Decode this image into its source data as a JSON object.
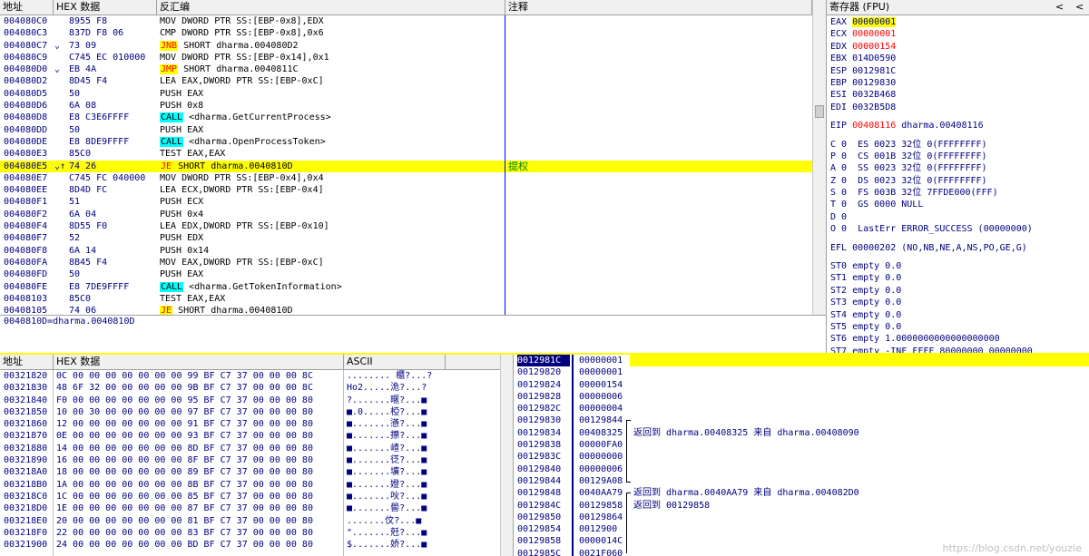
{
  "disasm": {
    "headers": {
      "addr": "地址",
      "hex": "HEX 数据",
      "disasm": "反汇编",
      "comment": "注释"
    },
    "rows": [
      {
        "addr": "004080C0",
        "mark": "",
        "hex": "8955 F8",
        "asm_pre": "MOV DWORD PTR SS:[EBP-0x8],EDX",
        "op": "",
        "asm_post": "",
        "comment": ""
      },
      {
        "addr": "004080C3",
        "mark": "",
        "hex": "837D F8 06",
        "asm_pre": "CMP DWORD PTR SS:[EBP-0x8],0x6",
        "op": "",
        "asm_post": "",
        "comment": ""
      },
      {
        "addr": "004080C7",
        "mark": "⌄",
        "hex": "73 09",
        "asm_pre": "",
        "op": "JNB",
        "optype": "jmp",
        "asm_post": " SHORT dharma.004080D2",
        "comment": ""
      },
      {
        "addr": "004080C9",
        "mark": "",
        "hex": "C745 EC 010000",
        "asm_pre": "MOV DWORD PTR SS:[EBP-0x14],0x1",
        "op": "",
        "asm_post": "",
        "comment": ""
      },
      {
        "addr": "004080D0",
        "mark": "⌄",
        "hex": "EB 4A",
        "asm_pre": "",
        "op": "JMP",
        "optype": "jmp",
        "asm_post": " SHORT dharma.0040811C",
        "comment": ""
      },
      {
        "addr": "004080D2",
        "mark": "",
        "hex": "8D45 F4",
        "asm_pre": "LEA EAX,DWORD PTR SS:[EBP-0xC]",
        "op": "",
        "asm_post": "",
        "comment": ""
      },
      {
        "addr": "004080D5",
        "mark": "",
        "hex": "50",
        "asm_pre": "PUSH EAX",
        "op": "",
        "asm_post": "",
        "comment": ""
      },
      {
        "addr": "004080D6",
        "mark": "",
        "hex": "6A 08",
        "asm_pre": "PUSH 0x8",
        "op": "",
        "asm_post": "",
        "comment": ""
      },
      {
        "addr": "004080D8",
        "mark": "",
        "hex": "E8 C3E6FFFF",
        "asm_pre": "",
        "op": "CALL",
        "optype": "call",
        "asm_post": " <dharma.GetCurrentProcess>",
        "comment": ""
      },
      {
        "addr": "004080DD",
        "mark": "",
        "hex": "50",
        "asm_pre": "PUSH EAX",
        "op": "",
        "asm_post": "",
        "comment": ""
      },
      {
        "addr": "004080DE",
        "mark": "",
        "hex": "E8 8DE9FFFF",
        "asm_pre": "",
        "op": "CALL",
        "optype": "call",
        "asm_post": " <dharma.OpenProcessToken>",
        "comment": ""
      },
      {
        "addr": "004080E3",
        "mark": "",
        "hex": "85C0",
        "asm_pre": "TEST EAX,EAX",
        "op": "",
        "asm_post": "",
        "comment": ""
      },
      {
        "addr": "004080E5",
        "mark": "⌄↑",
        "hex": "74 26",
        "asm_pre": "",
        "op": "JE",
        "optype": "jmpsel",
        "asm_post": " SHORT dharma.0040810D",
        "comment": "提权",
        "selected": true
      },
      {
        "addr": "004080E7",
        "mark": "",
        "hex": "C745 FC 040000",
        "asm_pre": "MOV DWORD PTR SS:[EBP-0x4],0x4",
        "op": "",
        "asm_post": "",
        "comment": ""
      },
      {
        "addr": "004080EE",
        "mark": "",
        "hex": "8D4D FC",
        "asm_pre": "LEA ECX,DWORD PTR SS:[EBP-0x4]",
        "op": "",
        "asm_post": "",
        "comment": ""
      },
      {
        "addr": "004080F1",
        "mark": "",
        "hex": "51",
        "asm_pre": "PUSH ECX",
        "op": "",
        "asm_post": "",
        "comment": ""
      },
      {
        "addr": "004080F2",
        "mark": "",
        "hex": "6A 04",
        "asm_pre": "PUSH 0x4",
        "op": "",
        "asm_post": "",
        "comment": ""
      },
      {
        "addr": "004080F4",
        "mark": "",
        "hex": "8D55 F0",
        "asm_pre": "LEA EDX,DWORD PTR SS:[EBP-0x10]",
        "op": "",
        "asm_post": "",
        "comment": ""
      },
      {
        "addr": "004080F7",
        "mark": "",
        "hex": "52",
        "asm_pre": "PUSH EDX",
        "op": "",
        "asm_post": "",
        "comment": ""
      },
      {
        "addr": "004080F8",
        "mark": "",
        "hex": "6A 14",
        "asm_pre": "PUSH 0x14",
        "op": "",
        "asm_post": "",
        "comment": ""
      },
      {
        "addr": "004080FA",
        "mark": "",
        "hex": "8B45 F4",
        "asm_pre": "MOV EAX,DWORD PTR SS:[EBP-0xC]",
        "op": "",
        "asm_post": "",
        "comment": ""
      },
      {
        "addr": "004080FD",
        "mark": "",
        "hex": "50",
        "asm_pre": "PUSH EAX",
        "op": "",
        "asm_post": "",
        "comment": ""
      },
      {
        "addr": "004080FE",
        "mark": "",
        "hex": "E8 7DE9FFFF",
        "asm_pre": "",
        "op": "CALL",
        "optype": "call",
        "asm_post": " <dharma.GetTokenInformation>",
        "comment": ""
      },
      {
        "addr": "00408103",
        "mark": "",
        "hex": "85C0",
        "asm_pre": "TEST EAX,EAX",
        "op": "",
        "asm_post": "",
        "comment": ""
      },
      {
        "addr": "00408105",
        "mark": "",
        "hex": "74 06",
        "asm_pre": "",
        "op": "JE",
        "optype": "jmp",
        "asm_post": " SHORT dharma.0040810D",
        "comment": ""
      }
    ],
    "info_line": "0040810D=dharma.0040810D"
  },
  "registers": {
    "title": "寄存器 (FPU)",
    "gp": [
      {
        "name": "EAX",
        "value": "00000001",
        "style": "hl"
      },
      {
        "name": "ECX",
        "value": "00000001",
        "style": "red"
      },
      {
        "name": "EDX",
        "value": "00000154",
        "style": "red"
      },
      {
        "name": "EBX",
        "value": "014D0590",
        "style": ""
      },
      {
        "name": "ESP",
        "value": "0012981C",
        "style": ""
      },
      {
        "name": "EBP",
        "value": "00129830",
        "style": ""
      },
      {
        "name": "ESI",
        "value": "0032B468",
        "style": ""
      },
      {
        "name": "EDI",
        "value": "0032B5D8",
        "style": ""
      }
    ],
    "eip": {
      "name": "EIP",
      "value": "00408116",
      "label": " dharma.00408116"
    },
    "flags": [
      "C 0  ES 0023 32位 0(FFFFFFFF)",
      "P 0  CS 001B 32位 0(FFFFFFFF)",
      "A 0  SS 0023 32位 0(FFFFFFFF)",
      "Z 0  DS 0023 32位 0(FFFFFFFF)",
      "S 0  FS 003B 32位 7FFDE000(FFF)",
      "T 0  GS 0000 NULL",
      "D 0",
      "O 0  LastErr ERROR_SUCCESS (00000000)"
    ],
    "efl": "EFL 00000202 (NO,NB,NE,A,NS,PO,GE,G)",
    "fpu": [
      "ST0 empty 0.0",
      "ST1 empty 0.0",
      "ST2 empty 0.0",
      "ST3 empty 0.0",
      "ST4 empty 0.0",
      "ST5 empty 0.0",
      "ST6 empty 1.0000000000000000000",
      "ST7 empty -INF FFFF 80000000 00000000"
    ],
    "nav_left": "<",
    "nav_right": "<"
  },
  "dump": {
    "headers": {
      "addr": "地址",
      "hex": "HEX 数据",
      "ascii": "ASCII"
    },
    "rows": [
      {
        "addr": "00321820",
        "hex": "0C 00 00 00 00 00 00 00 99 BF C7 37 00 00 00 8C",
        "ascii": "........ 櫃?...?"
      },
      {
        "addr": "00321830",
        "hex": "48 6F 32 00 00 00 00 00 9B BF C7 37 00 00 00 8C",
        "ascii": "Ho2.....洈?...?"
      },
      {
        "addr": "00321840",
        "hex": "F0 00 00 00 00 00 00 00 95 BF C7 37 00 00 00 80",
        "ascii": "?.......暱?...■"
      },
      {
        "addr": "00321850",
        "hex": "10 00 30 00 00 00 00 00 97 BF C7 37 00 00 00 80",
        "ascii": "■.0.....椏?...■"
      },
      {
        "addr": "00321860",
        "hex": "12 00 00 00 00 00 00 00 91 BF C7 37 00 00 00 80",
        "ascii": "■.......懣?...■"
      },
      {
        "addr": "00321870",
        "hex": "0E 00 00 00 00 00 00 00 93 BF C7 37 00 00 00 80",
        "ascii": "■.......摽?...■"
      },
      {
        "addr": "00321880",
        "hex": "14 00 00 00 00 00 00 00 8D BF C7 37 00 00 00 80",
        "ascii": "■.......嵖?...■"
      },
      {
        "addr": "00321890",
        "hex": "16 00 00 00 00 00 00 00 8F BF C7 37 00 00 00 80",
        "ascii": "■.......徔?...■"
      },
      {
        "addr": "003218A0",
        "hex": "18 00 00 00 00 00 00 00 89 BF C7 37 00 00 00 80",
        "ascii": "■.......壙?...■"
      },
      {
        "addr": "003218B0",
        "hex": "1A 00 00 00 00 00 00 00 8B BF C7 37 00 00 00 80",
        "ascii": "■.......嬁?...■"
      },
      {
        "addr": "003218C0",
        "hex": "1C 00 00 00 00 00 00 00 85 BF C7 37 00 00 00 80",
        "ascii": "■.......吙?...■"
      },
      {
        "addr": "003218D0",
        "hex": "1E 00 00 00 00 00 00 00 87 BF C7 37 00 00 00 80",
        "ascii": "■.......嚳?...■"
      },
      {
        "addr": "003218E0",
        "hex": "20 00 00 00 00 00 00 00 81 BF C7 37 00 00 00 80",
        "ascii": " .......伩?...■"
      },
      {
        "addr": "003218F0",
        "hex": "22 00 00 00 00 00 00 00 83 BF C7 37 00 00 00 80",
        "ascii": "\".......兛?...■"
      },
      {
        "addr": "00321900",
        "hex": "24 00 00 00 00 00 00 00 BD BF C7 37 00 00 00 80",
        "ascii": "$.......娇?...■"
      }
    ]
  },
  "stack": {
    "rows": [
      {
        "addr": "0012981C",
        "value": "00000001",
        "comment": "",
        "selected": true
      },
      {
        "addr": "00129820",
        "value": "00000001",
        "comment": ""
      },
      {
        "addr": "00129824",
        "value": "00000154",
        "comment": ""
      },
      {
        "addr": "00129828",
        "value": "00000006",
        "comment": ""
      },
      {
        "addr": "0012982C",
        "value": "00000004",
        "comment": ""
      },
      {
        "addr": "00129830",
        "value": "00129844",
        "comment": "",
        "bracket": "start"
      },
      {
        "addr": "00129834",
        "value": "00408325",
        "comment": "返回到 dharma.00408325 来自 dharma.00408090"
      },
      {
        "addr": "00129838",
        "value": "00000FA0",
        "comment": ""
      },
      {
        "addr": "0012983C",
        "value": "00000000",
        "comment": ""
      },
      {
        "addr": "00129840",
        "value": "00000006",
        "comment": ""
      },
      {
        "addr": "00129844",
        "value": "00129A08",
        "comment": "",
        "bracket": "end"
      },
      {
        "addr": "00129848",
        "value": "0040AA79",
        "comment": "返回到 dharma.0040AA79 来自 dharma.004082D0",
        "bracket": "start"
      },
      {
        "addr": "0012984C",
        "value": "00129858",
        "comment": "返回到 00129858"
      },
      {
        "addr": "00129850",
        "value": "00129864",
        "comment": ""
      },
      {
        "addr": "00129854",
        "value": "0012900",
        "comment": ""
      },
      {
        "addr": "00129858",
        "value": "0000014C",
        "comment": ""
      },
      {
        "addr": "0012985C",
        "value": "0021F060",
        "comment": ""
      }
    ],
    "watermark": "https://blog.csdn.net/youzie"
  }
}
